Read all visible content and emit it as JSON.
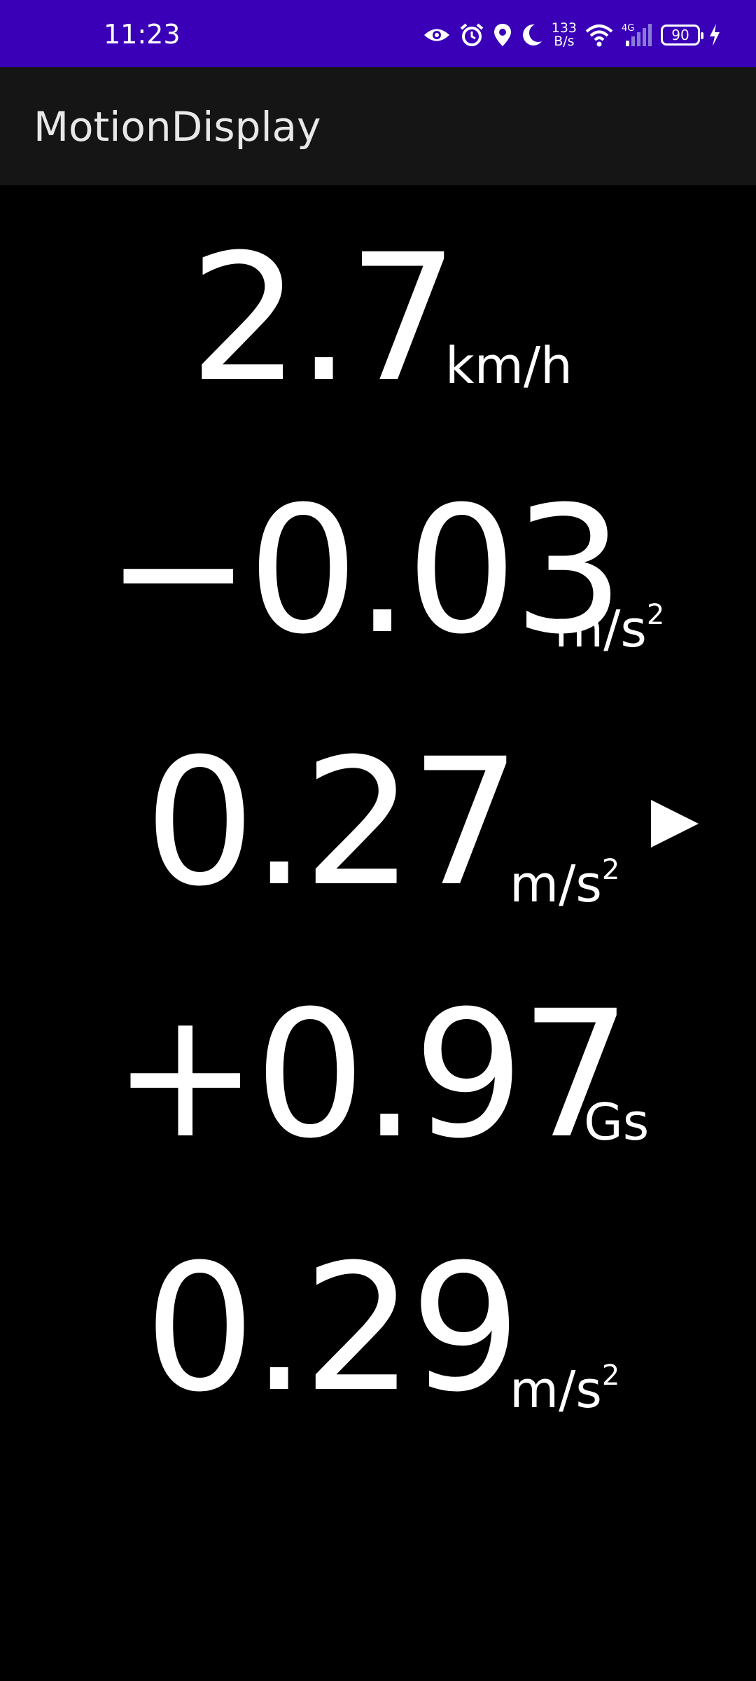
{
  "status_bar": {
    "time": "11:23",
    "net_speed_value": "133",
    "net_speed_unit": "B/s",
    "network_type": "4G",
    "battery_level": "90",
    "icons": [
      "eye-icon",
      "alarm-icon",
      "location-icon",
      "moon-icon",
      "wifi-icon",
      "signal-icon",
      "battery-icon",
      "charging-icon"
    ]
  },
  "app_bar": {
    "title": "MotionDisplay"
  },
  "metrics": {
    "speed": {
      "value": "2.7",
      "unit": "km/h"
    },
    "accel_1": {
      "value": "−0.03",
      "unit": "m/s",
      "unit_sup": "2"
    },
    "accel_2": {
      "value": "0.27",
      "unit": "m/s",
      "unit_sup": "2"
    },
    "g_force": {
      "value": "+0.97",
      "unit": "Gs"
    },
    "accel_3": {
      "value": "0.29",
      "unit": "m/s",
      "unit_sup": "2"
    }
  },
  "colors": {
    "status_bar": "#3a00b8",
    "app_bar": "#151515",
    "background": "#000000",
    "text": "#ffffff"
  }
}
